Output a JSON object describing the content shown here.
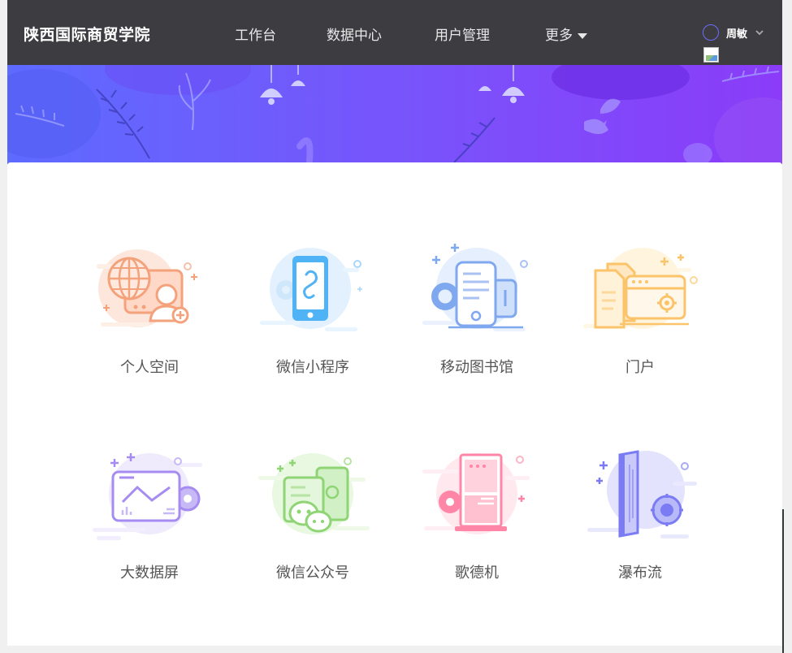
{
  "header": {
    "brand": "陕西国际商贸学院",
    "nav": [
      {
        "label": "工作台"
      },
      {
        "label": "数据中心"
      },
      {
        "label": "用户管理"
      },
      {
        "label": "更多"
      }
    ],
    "user_name": "周敏"
  },
  "apps": [
    {
      "label": "个人空间",
      "icon": "personal-space-icon",
      "color": "#f4a27b"
    },
    {
      "label": "微信小程序",
      "icon": "mini-program-icon",
      "color": "#4fb3f5"
    },
    {
      "label": "移动图书馆",
      "icon": "mobile-library-icon",
      "color": "#7fa8ef"
    },
    {
      "label": "门户",
      "icon": "portal-icon",
      "color": "#fbc46a"
    },
    {
      "label": "大数据屏",
      "icon": "big-data-screen-icon",
      "color": "#a68cf0"
    },
    {
      "label": "微信公众号",
      "icon": "wechat-official-icon",
      "color": "#8fd475"
    },
    {
      "label": "歌德机",
      "icon": "kiosk-icon",
      "color": "#ff86a6"
    },
    {
      "label": "瀑布流",
      "icon": "waterfall-icon",
      "color": "#7b7cf3"
    }
  ]
}
